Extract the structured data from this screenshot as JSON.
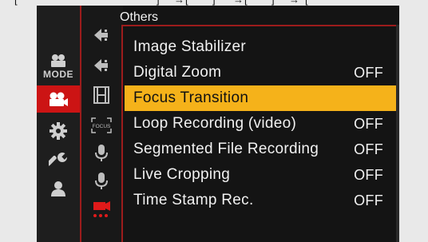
{
  "breadcrumb_partial": {
    "items": [
      "[",
      "]",
      "→",
      "[",
      "]",
      "→",
      "[",
      "]",
      "→",
      "["
    ]
  },
  "header": {
    "title": "Others"
  },
  "sidebar": {
    "mode_label": "MODE",
    "categories": [
      {
        "icon": "photo-camera-icon",
        "active": false
      },
      {
        "icon": "video-camera-icon",
        "active": true
      },
      {
        "icon": "gear-icon",
        "active": false
      },
      {
        "icon": "wrench-icon",
        "active": false
      },
      {
        "icon": "person-icon",
        "active": false
      }
    ]
  },
  "subtabs": [
    {
      "icon": "arrow-icon"
    },
    {
      "icon": "arrow-icon"
    },
    {
      "icon": "film-strip-icon"
    },
    {
      "icon": "focus-frame-icon",
      "label": "FOCUS"
    },
    {
      "icon": "microphone-icon"
    },
    {
      "icon": "microphone-icon"
    },
    {
      "icon": "video-camera-menu-icon",
      "active": true
    }
  ],
  "menu": {
    "items": [
      {
        "label": "Image Stabilizer",
        "value": ""
      },
      {
        "label": "Digital Zoom",
        "value": "OFF"
      },
      {
        "label": "Focus Transition",
        "value": "",
        "selected": true
      },
      {
        "label": "Loop Recording (video)",
        "value": "OFF"
      },
      {
        "label": "Segmented File Recording",
        "value": "OFF"
      },
      {
        "label": "Live Cropping",
        "value": "OFF"
      },
      {
        "label": "Time Stamp Rec.",
        "value": "OFF"
      }
    ]
  },
  "colors": {
    "accent_red": "#cc1414",
    "selected_highlight": "#f5b21a",
    "screen_background": "#141414"
  }
}
